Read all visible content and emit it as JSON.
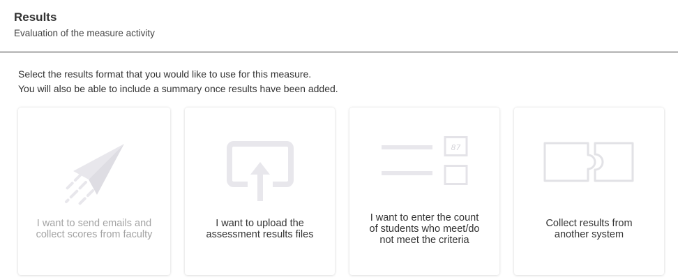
{
  "header": {
    "title": "Results",
    "subtitle": "Evaluation of the measure activity"
  },
  "instructions": {
    "line1": "Select the results format that you would like to use for this measure.",
    "line2": "You will also be able to include a summary once results have been added."
  },
  "cards": [
    {
      "icon": "paper-plane-icon",
      "line1": "I want to send emails and",
      "line2": "collect scores from faculty",
      "state": "disabled"
    },
    {
      "icon": "upload-icon",
      "line1": "I want to upload the",
      "line2": "assessment results files",
      "state": "enabled"
    },
    {
      "icon": "count-entry-icon",
      "icon_text": "87",
      "line1": "I want to enter the count",
      "line2": "of students who meet/do",
      "line3": "not meet the criteria",
      "state": "enabled"
    },
    {
      "icon": "puzzle-icon",
      "line1": "Collect results from",
      "line2": "another system",
      "state": "enabled"
    }
  ],
  "colors": {
    "icon_fill": "#e8e7ec",
    "icon_stroke": "#e2e2e6",
    "text_dark": "#333333",
    "text_disabled": "#a3a3a3",
    "header_rule": "#2b2b2b"
  }
}
